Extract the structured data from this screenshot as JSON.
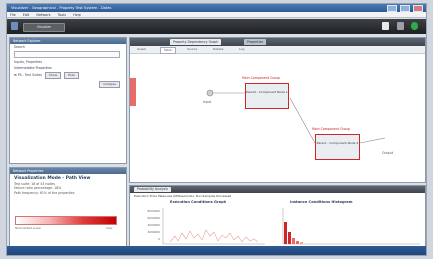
{
  "window": {
    "title": "Visualizer - Geographical - Property Test System - Dates"
  },
  "menu": {
    "items": [
      "File",
      "Edit",
      "Network",
      "Tools",
      "Help"
    ]
  },
  "toolbar": {
    "main_label": "Visualize"
  },
  "left_panel": {
    "header": "Network Explorer",
    "search_label": "Search",
    "filter_label": "Inputs, Properties",
    "group_label": "Intermediate Properties",
    "item_label": "PS - Test Suites",
    "button_show": "Show",
    "button_hide": "Hide",
    "button_collapse": "Collapse"
  },
  "info_panel": {
    "header": "Network Properties",
    "title": "Visualization Mode - Path View",
    "line1": "Test suite: 18 of 43 nodes",
    "line2": "Failure ratio percentage: 18%",
    "line3": "Path frequency: 61% of the properties",
    "scale_min": "Normalized scale",
    "scale_max": "max",
    "heat_colors": [
      "#ffffff",
      "#f7b3b3",
      "#e23c3c",
      "#c40000"
    ]
  },
  "main_panel": {
    "tabs": [
      "Property Dependency Graph",
      "Properties"
    ],
    "subtabs": [
      "Graph",
      "Table",
      "Source",
      "Details",
      "Log"
    ],
    "node_top": {
      "title": "Main Component Group",
      "label": "Parent - Component Node 1"
    },
    "node_bottom": {
      "title": "Main Component Group",
      "label": "Parent - Component Node 2"
    },
    "node_dot": {
      "label": "Input"
    },
    "node_end": {
      "label": "Output"
    }
  },
  "bottom_panel": {
    "header": "Probability Analysis",
    "chart_left_title": "Execution Conditions Graph",
    "chart_right_title": "Instance Conditions Histogram",
    "section_label": "Execution Time Measures (Milliseconds): Run Samples Processed",
    "axis_ticks": [
      "8000000",
      "6000000",
      "4000000",
      "2000000",
      "0"
    ]
  },
  "colors": {
    "accent": "#2f5b95",
    "alert": "#d12626"
  }
}
